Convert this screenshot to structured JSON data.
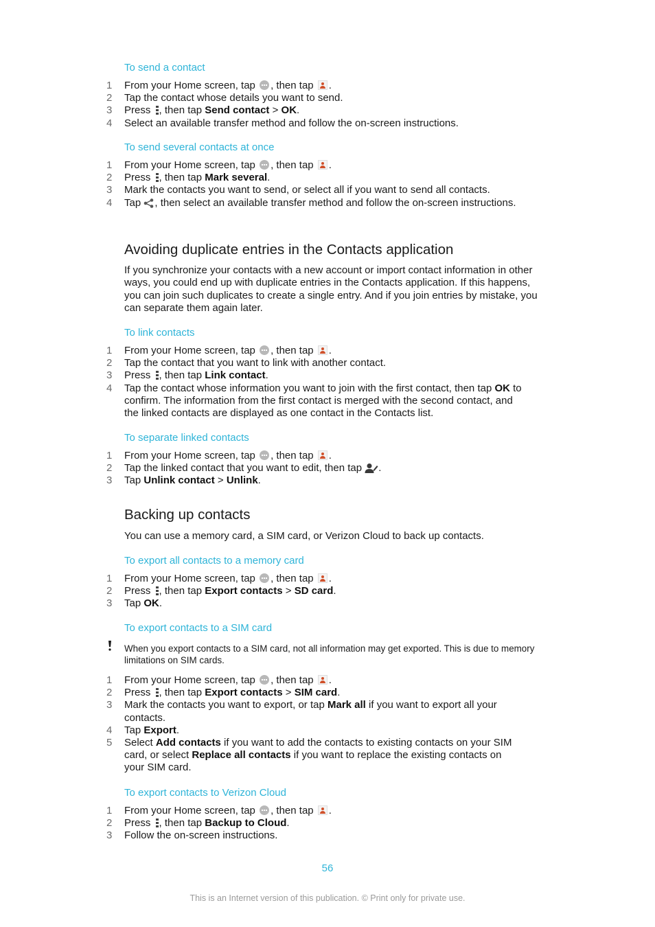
{
  "sections": {
    "send_contact": {
      "title": "To send a contact",
      "steps": [
        {
          "n": "1",
          "a": "From your Home screen, tap ",
          "b": ", then tap ",
          "c": "."
        },
        {
          "n": "2",
          "text": "Tap the contact whose details you want to send."
        },
        {
          "n": "3",
          "a": "Press ",
          "b": ", then tap ",
          "bold1": "Send contact",
          "sep": " > ",
          "bold2": "OK",
          "c": "."
        },
        {
          "n": "4",
          "text": "Select an available transfer method and follow the on-screen instructions."
        }
      ]
    },
    "send_several": {
      "title": "To send several contacts at once",
      "steps": [
        {
          "n": "1",
          "a": "From your Home screen, tap ",
          "b": ", then tap ",
          "c": "."
        },
        {
          "n": "2",
          "a": "Press ",
          "b": ", then tap ",
          "bold1": "Mark several",
          "c": "."
        },
        {
          "n": "3",
          "text": "Mark the contacts you want to send, or select all if you want to send all contacts."
        },
        {
          "n": "4",
          "a": "Tap ",
          "b": ", then select an available transfer method and follow the on-screen instructions."
        }
      ]
    },
    "avoiding": {
      "heading": "Avoiding duplicate entries in the Contacts application",
      "body": "If you synchronize your contacts with a new account or import contact information in other ways, you could end up with duplicate entries in the Contacts application. If this happens, you can join such duplicates to create a single entry. And if you join entries by mistake, you can separate them again later."
    },
    "link": {
      "title": "To link contacts",
      "steps": [
        {
          "n": "1",
          "a": "From your Home screen, tap ",
          "b": ", then tap ",
          "c": "."
        },
        {
          "n": "2",
          "text": "Tap the contact that you want to link with another contact."
        },
        {
          "n": "3",
          "a": "Press ",
          "b": ", then tap ",
          "bold1": "Link contact",
          "c": "."
        },
        {
          "n": "4",
          "a": "Tap the contact whose information you want to join with the first contact, then tap ",
          "bold1": "OK",
          "c": " to confirm. The information from the first contact is merged with the second contact, and the linked contacts are displayed as one contact in the Contacts list."
        }
      ]
    },
    "separate": {
      "title": "To separate linked contacts",
      "steps": [
        {
          "n": "1",
          "a": "From your Home screen, tap ",
          "b": ", then tap ",
          "c": "."
        },
        {
          "n": "2",
          "a": "Tap the linked contact that you want to edit, then tap ",
          "c": "."
        },
        {
          "n": "3",
          "a": "Tap ",
          "bold1": "Unlink contact",
          "sep": " > ",
          "bold2": "Unlink",
          "c": "."
        }
      ]
    },
    "backing": {
      "heading": "Backing up contacts",
      "body": "You can use a memory card, a SIM card, or Verizon Cloud to back up contacts."
    },
    "export_memory": {
      "title": "To export all contacts to a memory card",
      "steps": [
        {
          "n": "1",
          "a": "From your Home screen, tap ",
          "b": ", then tap ",
          "c": "."
        },
        {
          "n": "2",
          "a": "Press ",
          "b": ", then tap ",
          "bold1": "Export contacts",
          "sep": " > ",
          "bold2": "SD card",
          "c": "."
        },
        {
          "n": "3",
          "a": "Tap ",
          "bold1": "OK",
          "c": "."
        }
      ]
    },
    "export_sim": {
      "title": "To export contacts to a SIM card",
      "note": "When you export contacts to a SIM card, not all information may get exported. This is due to memory limitations on SIM cards.",
      "steps": [
        {
          "n": "1",
          "a": "From your Home screen, tap ",
          "b": ", then tap ",
          "c": "."
        },
        {
          "n": "2",
          "a": "Press ",
          "b": ", then tap ",
          "bold1": "Export contacts",
          "sep": " > ",
          "bold2": "SIM card",
          "c": "."
        },
        {
          "n": "3",
          "a": "Mark the contacts you want to export, or tap ",
          "bold1": "Mark all",
          "c": " if you want to export all your contacts."
        },
        {
          "n": "4",
          "a": "Tap ",
          "bold1": "Export",
          "c": "."
        },
        {
          "n": "5",
          "a": "Select ",
          "bold1": "Add contacts",
          "mid": " if you want to add the contacts to existing contacts on your SIM card, or select ",
          "bold2": "Replace all contacts",
          "c": " if you want to replace the existing contacts on your SIM card."
        }
      ]
    },
    "export_cloud": {
      "title": "To export contacts to Verizon Cloud",
      "steps": [
        {
          "n": "1",
          "a": "From your Home screen, tap ",
          "b": ", then tap ",
          "c": "."
        },
        {
          "n": "2",
          "a": "Press ",
          "b": ", then tap ",
          "bold1": "Backup to Cloud",
          "c": "."
        },
        {
          "n": "3",
          "text": "Follow the on-screen instructions."
        }
      ]
    }
  },
  "page_number": "56",
  "footer": "This is an Internet version of this publication. © Print only for private use.",
  "colors": {
    "accent": "#2eb4d8",
    "text": "#1a1a1a",
    "footer": "#9a9a9a",
    "contacts_icon": "#d0502a"
  }
}
